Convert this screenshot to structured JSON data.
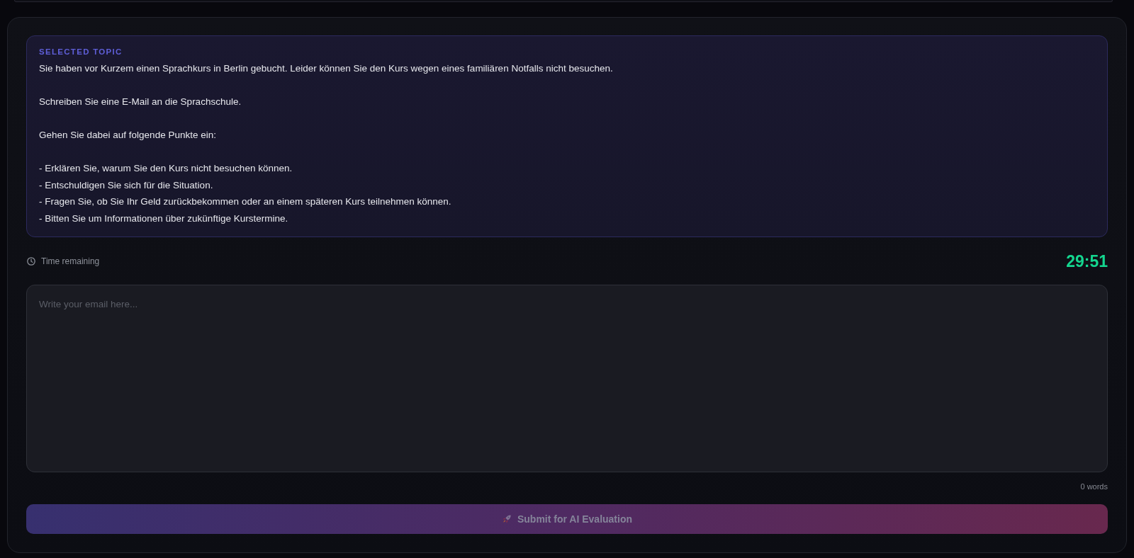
{
  "topic": {
    "label": "SELECTED TOPIC",
    "paragraphs": [
      "Sie haben vor Kurzem einen Sprachkurs in Berlin gebucht. Leider können Sie den Kurs wegen eines familiären Notfalls nicht besuchen.",
      "Schreiben Sie eine E-Mail an die Sprachschule.",
      "Gehen Sie dabei auf folgende Punkte ein:"
    ],
    "points": [
      "- Erklären Sie, warum Sie den Kurs nicht besuchen können.",
      "- Entschuldigen Sie sich für die Situation.",
      "- Fragen Sie, ob Sie Ihr Geld zurückbekommen oder an einem späteren Kurs teilnehmen können.",
      "- Bitten Sie um Informationen über zukünftige Kurstermine."
    ]
  },
  "timer": {
    "label": "Time remaining",
    "value": "29:51"
  },
  "editor": {
    "placeholder": "Write your email here...",
    "word_count": "0 words"
  },
  "submit_button": {
    "label": "Submit for AI Evaluation",
    "disabled": true
  }
}
